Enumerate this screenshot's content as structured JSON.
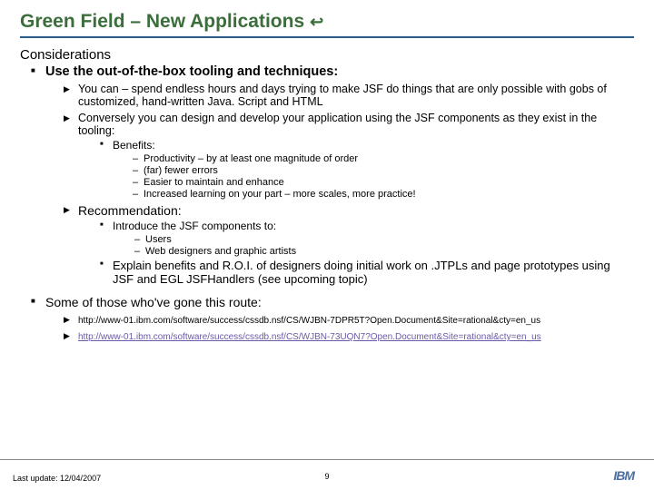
{
  "title": "Green Field – New Applications",
  "heading": "Considerations",
  "bullet1": "Use the out-of-the-box tooling and techniques:",
  "sub1a": "You can – spend endless hours and days trying to make JSF do things that are only possible with gobs of customized, hand-written Java. Script and HTML",
  "sub1b": "Conversely you can design and develop your application using the JSF components as they exist in the tooling:",
  "benefits_label": "Benefits:",
  "benefits": [
    "Productivity – by at least one magnitude of order",
    "(far) fewer errors",
    "Easier to maintain and enhance",
    "Increased learning on  your part – more scales, more practice!"
  ],
  "recommendation_label": "Recommendation:",
  "rec_intro": "Introduce the JSF components to:",
  "rec_items": [
    "Users",
    "Web designers and graphic artists"
  ],
  "rec_explain": "Explain benefits and R.O.I. of designers doing initial work on .JTPLs and page prototypes using JSF and EGL JSFHandlers (see upcoming topic)",
  "some_label": "Some of those who've gone this route:",
  "url1": "http://www-01.ibm.com/software/success/cssdb.nsf/CS/WJBN-7DPR5T?Open.Document&Site=rational&cty=en_us",
  "url2": "http://www-01.ibm.com/software/success/cssdb.nsf/CS/WJBN-73UQN7?Open.Document&Site=rational&cty=en_us",
  "last_update": "Last update: 12/04/2007",
  "page_num": "9",
  "logo": "IBM"
}
